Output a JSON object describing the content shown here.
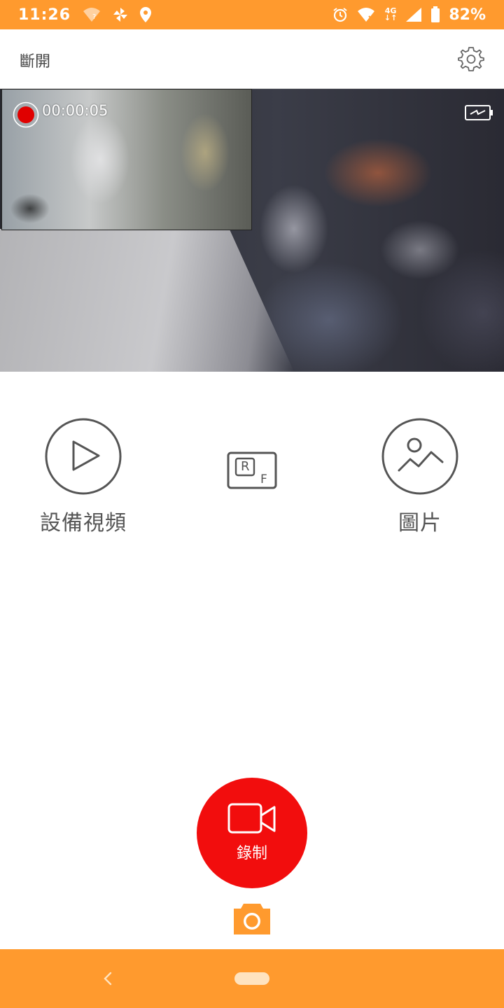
{
  "status_bar": {
    "time": "11:26",
    "network_type": "4G",
    "battery_percent": "82%",
    "color": "#FF9A2E"
  },
  "header": {
    "disconnect_label": "斷開"
  },
  "preview": {
    "record_timer": "00:00:05"
  },
  "actions": {
    "device_video_label": "設備視頻",
    "rf_icon_letters": {
      "r": "R",
      "f": "F"
    },
    "pictures_label": "圖片"
  },
  "record": {
    "label": "錄制",
    "color": "#F20D0D"
  },
  "icons": [
    "wifi-icon",
    "pinwheel-icon",
    "location-icon",
    "alarm-icon",
    "signal-icon",
    "battery-icon",
    "gear-icon",
    "record-dot-icon",
    "charging-battery-icon",
    "play-icon",
    "rf-icon",
    "image-icon",
    "video-camera-icon",
    "camera-icon",
    "back-icon",
    "home-pill-icon"
  ],
  "accent_color": "#FF9A2E"
}
